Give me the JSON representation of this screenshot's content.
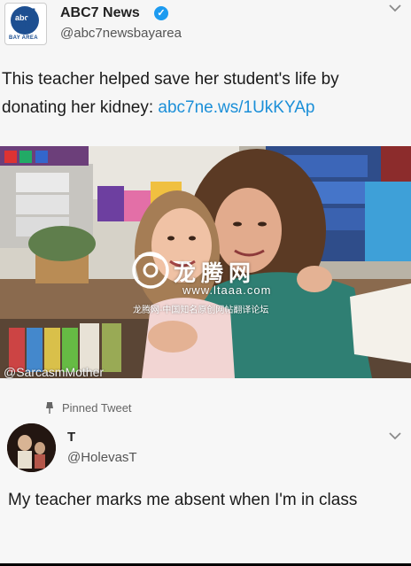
{
  "tweet1": {
    "display_name": "ABC7 News",
    "handle": "@abc7newsbayarea",
    "logo_text": "abc",
    "logo_number": "7",
    "logo_sub": "BAY AREA",
    "text": "This teacher helped save her student's life by donating her kidney: ",
    "link": "abc7ne.ws/1UkKYAp",
    "photo_credit": "@SarcasmMother",
    "verified_icon": "check-icon"
  },
  "watermark": {
    "brand": "龙腾网",
    "url": "www.ltaaa.com",
    "desc": "龙腾网-中国知名原创网帖翻译论坛"
  },
  "tweet2": {
    "pinned_label": "Pinned Tweet",
    "display_name": "T",
    "handle": "@HolevasT",
    "text": "My teacher marks me absent when I'm in class"
  },
  "colors": {
    "link": "#1b8fd8",
    "verified": "#1d9bf0",
    "abc_blue": "#1d4f91"
  }
}
